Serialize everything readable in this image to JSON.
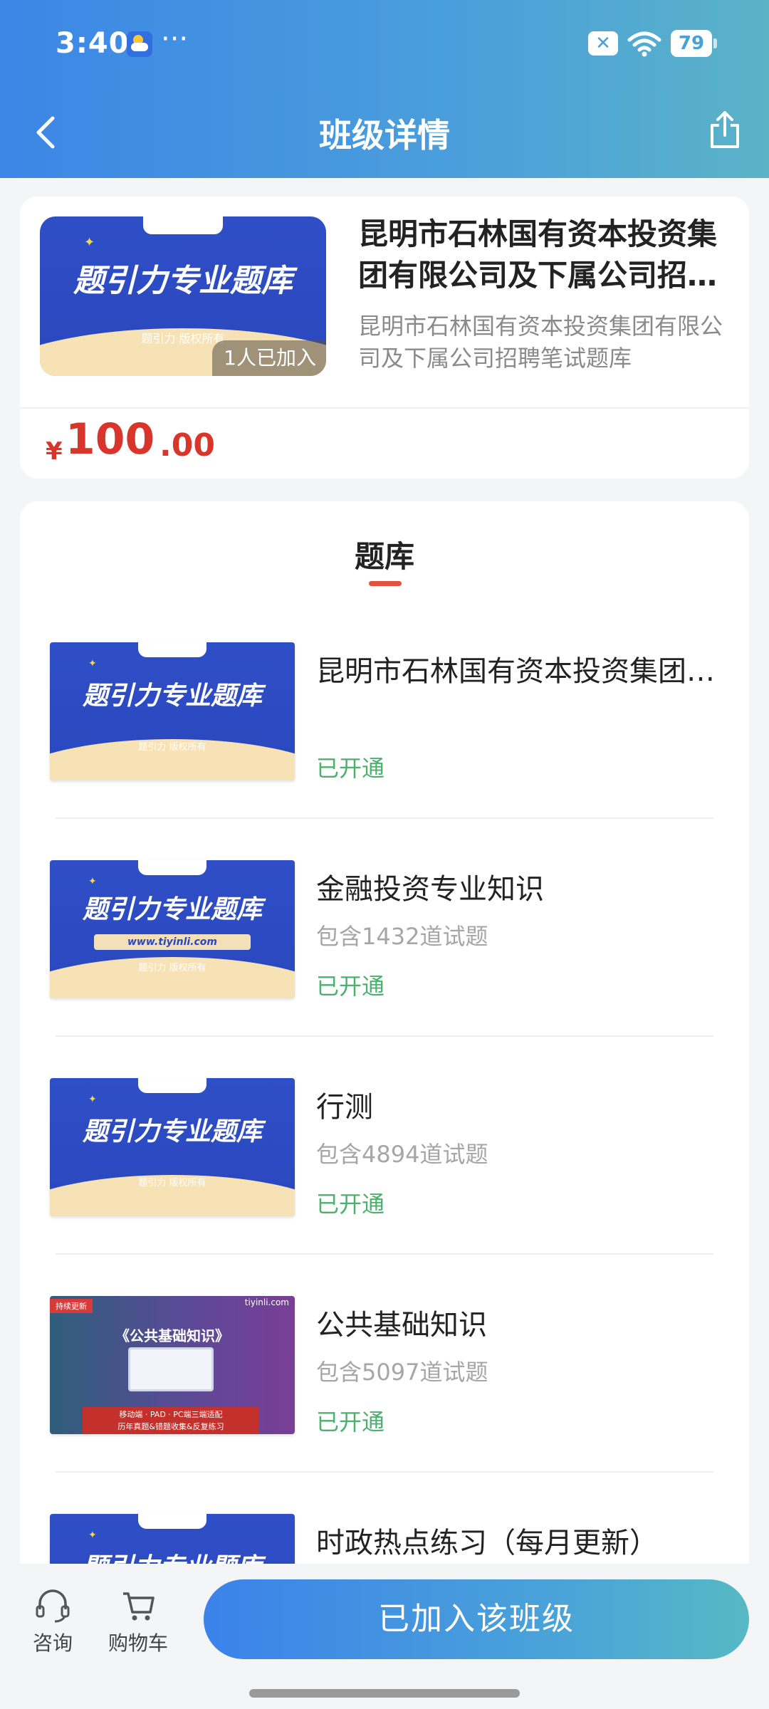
{
  "status_bar": {
    "time": "3:40",
    "battery": "79",
    "dots": "···",
    "x_badge": "✕"
  },
  "nav": {
    "title": "班级详情"
  },
  "class": {
    "title": "昆明市石林国有资本投资集团有限公司及下属公司招聘笔试题库",
    "description": "昆明市石林国有资本投资集团有限公司及下属公司招聘笔试题库",
    "joined": "1人已加入",
    "price_symbol": "¥",
    "price_int": "100",
    "price_dec": ".00"
  },
  "cover": {
    "main": "题引力专业题库",
    "sub": "题引力 版权所有",
    "tab": "题引力",
    "url": "www.tiyinli.com"
  },
  "cover_purple": {
    "tag": "持续更新",
    "brand": "tiyinli.com",
    "title": "《公共基础知识》",
    "foot1": "移动端 · PAD · PC端三端适配",
    "foot2": "历年真题&错题收集&反复练习"
  },
  "section": {
    "title": "题库"
  },
  "banks": [
    {
      "title": "昆明市石林国有资本投资集团有限公司及下属公司",
      "count": "",
      "status": "已开通"
    },
    {
      "title": "金融投资专业知识",
      "count": "包含1432道试题",
      "status": "已开通"
    },
    {
      "title": "行测",
      "count": "包含4894道试题",
      "status": "已开通"
    },
    {
      "title": "公共基础知识",
      "count": "包含5097道试题",
      "status": "已开通"
    },
    {
      "title": "时政热点练习（每月更新）",
      "count": "",
      "status": ""
    }
  ],
  "bottom": {
    "consult": "咨询",
    "cart": "购物车",
    "join_button": "已加入该班级"
  }
}
